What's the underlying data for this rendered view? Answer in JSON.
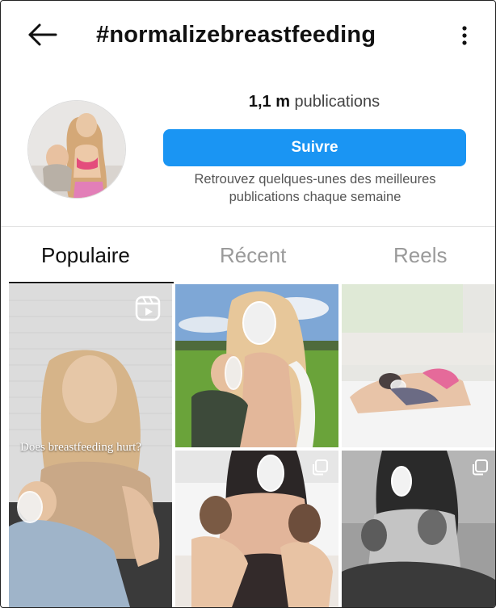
{
  "header": {
    "title": "#normalizebreastfeeding",
    "back_icon": "arrow-left-icon",
    "more_icon": "more-vertical-icon"
  },
  "profile": {
    "count": "1,1 m",
    "count_label": "publications",
    "follow_label": "Suivre",
    "tagline_line1": "Retrouvez quelques-unes des meilleures",
    "tagline_line2": "publications chaque semaine"
  },
  "tabs": [
    {
      "label": "Populaire",
      "active": true
    },
    {
      "label": "Récent",
      "active": false
    },
    {
      "label": "Reels",
      "active": false
    }
  ],
  "grid": {
    "reel_overlay_text": "Does breastfeeding hurt?"
  },
  "colors": {
    "accent": "#1a95f3",
    "text": "#111111",
    "muted": "#9a9a9a"
  }
}
